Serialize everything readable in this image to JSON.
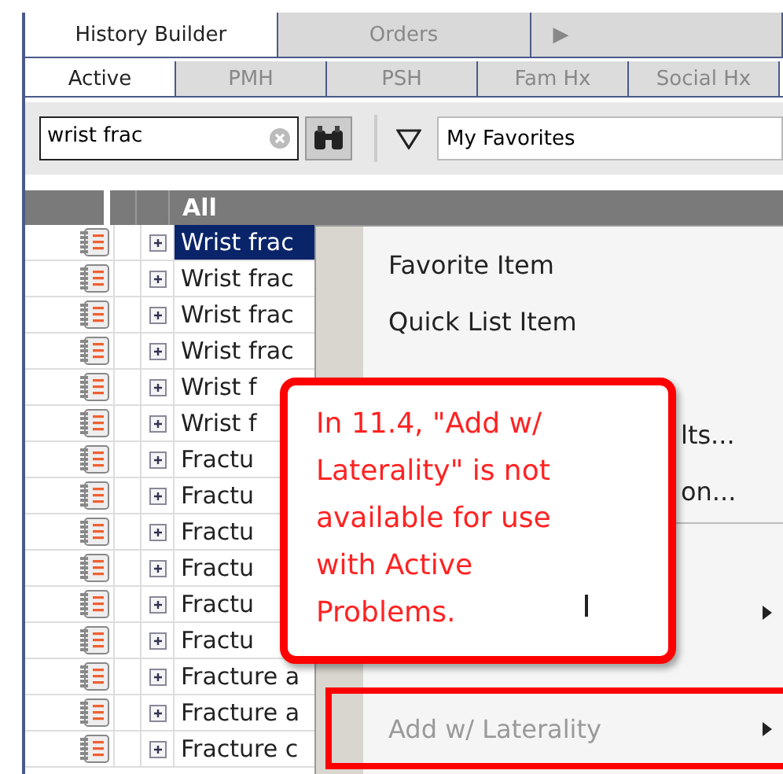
{
  "top_tabs": [
    {
      "label": "History Builder",
      "selected": true
    },
    {
      "label": "Orders",
      "selected": false
    },
    {
      "label": "▶",
      "selected": false
    }
  ],
  "sub_tabs": [
    {
      "label": "Active",
      "selected": true
    },
    {
      "label": "PMH",
      "selected": false
    },
    {
      "label": "PSH",
      "selected": false
    },
    {
      "label": "Fam Hx",
      "selected": false
    },
    {
      "label": "Social Hx",
      "selected": false
    }
  ],
  "search": {
    "value": "wrist frac"
  },
  "filter": {
    "value": "My Favorites"
  },
  "table": {
    "header": "All",
    "rows": [
      {
        "name": "Wrist frac",
        "selected": true
      },
      {
        "name": "Wrist frac",
        "selected": false
      },
      {
        "name": "Wrist frac",
        "selected": false
      },
      {
        "name": "Wrist frac",
        "selected": false
      },
      {
        "name": "Wrist f",
        "selected": false
      },
      {
        "name": "Wrist f",
        "selected": false
      },
      {
        "name": "Fractu",
        "selected": false
      },
      {
        "name": "Fractu",
        "selected": false
      },
      {
        "name": "Fractu",
        "selected": false
      },
      {
        "name": "Fractu",
        "selected": false
      },
      {
        "name": "Fractu",
        "selected": false
      },
      {
        "name": "Fractu",
        "selected": false
      },
      {
        "name": "Fracture a",
        "selected": false
      },
      {
        "name": "Fracture a",
        "selected": false
      },
      {
        "name": "Fracture c",
        "selected": false
      }
    ]
  },
  "context_menu": [
    {
      "label": "Favorite Item",
      "disabled": false,
      "submenu": false
    },
    {
      "label": "Quick List Item",
      "disabled": false,
      "submenu": false
    },
    {
      "kind": "covered",
      "submenu": false
    },
    {
      "kind": "fragment",
      "label": "lts...",
      "disabled": false,
      "submenu": false
    },
    {
      "kind": "fragment",
      "label": "on...",
      "disabled": false,
      "submenu": false
    },
    {
      "kind": "separator"
    },
    {
      "kind": "covered",
      "submenu": false
    },
    {
      "kind": "covered",
      "submenu": true
    },
    {
      "kind": "covered",
      "submenu": false
    },
    {
      "label": "Add w/ Laterality",
      "disabled": true,
      "submenu": true,
      "highlighted": true
    }
  ],
  "callout": {
    "text": "In 11.4, \"Add w/ Laterality\" is not available for use with Active Problems."
  }
}
